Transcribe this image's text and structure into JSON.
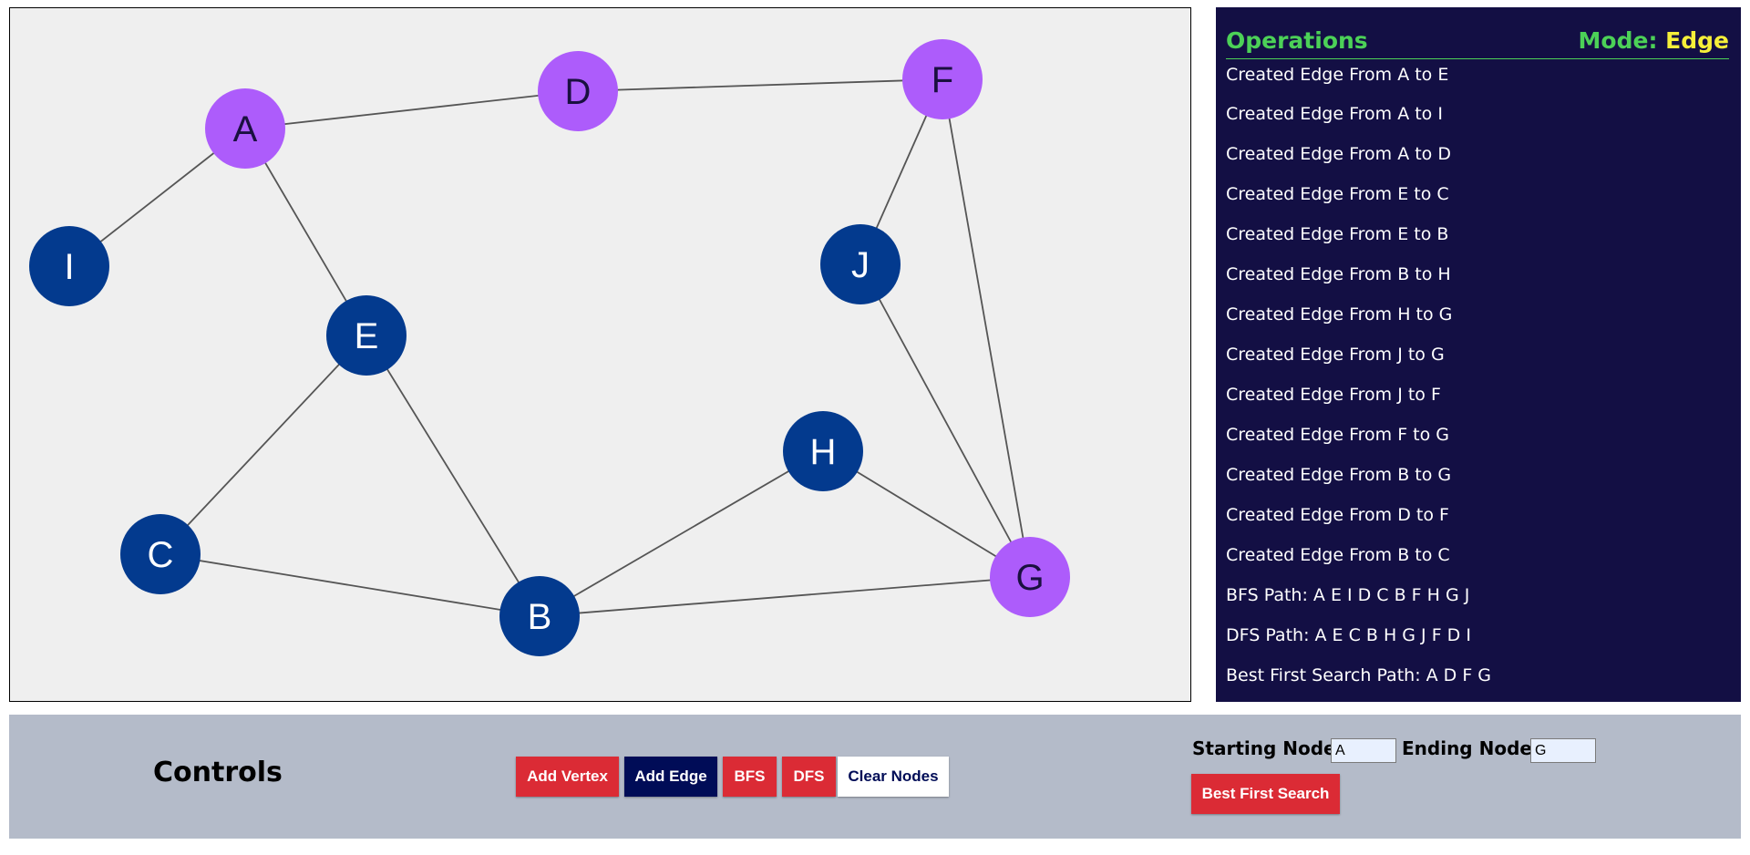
{
  "graph": {
    "nodes": [
      {
        "id": "A",
        "color": "#ad5cfb",
        "label_color": "#1a1040"
      },
      {
        "id": "D",
        "color": "#ad5cfb",
        "label_color": "#1a1040"
      },
      {
        "id": "F",
        "color": "#ad5cfb",
        "label_color": "#1a1040"
      },
      {
        "id": "I",
        "color": "#033a8e",
        "label_color": "#ffffff"
      },
      {
        "id": "J",
        "color": "#033a8e",
        "label_color": "#ffffff"
      },
      {
        "id": "E",
        "color": "#033a8e",
        "label_color": "#ffffff"
      },
      {
        "id": "H",
        "color": "#033a8e",
        "label_color": "#ffffff"
      },
      {
        "id": "C",
        "color": "#033a8e",
        "label_color": "#ffffff"
      },
      {
        "id": "B",
        "color": "#033a8e",
        "label_color": "#ffffff"
      },
      {
        "id": "G",
        "color": "#ad5cfb",
        "label_color": "#1a1040"
      }
    ],
    "edges": [
      [
        "A",
        "E"
      ],
      [
        "A",
        "I"
      ],
      [
        "A",
        "D"
      ],
      [
        "E",
        "C"
      ],
      [
        "E",
        "B"
      ],
      [
        "B",
        "H"
      ],
      [
        "H",
        "G"
      ],
      [
        "J",
        "G"
      ],
      [
        "J",
        "F"
      ],
      [
        "F",
        "G"
      ],
      [
        "B",
        "G"
      ],
      [
        "D",
        "F"
      ],
      [
        "B",
        "C"
      ]
    ]
  },
  "operations": {
    "title": "Operations",
    "mode_label": "Mode:",
    "mode_value": "Edge",
    "items": [
      "Created Edge From A to E",
      "Created Edge From A to I",
      "Created Edge From A to D",
      "Created Edge From E to C",
      "Created Edge From E to B",
      "Created Edge From B to H",
      "Created Edge From H to G",
      "Created Edge From J to G",
      "Created Edge From J to F",
      "Created Edge From F to G",
      "Created Edge From B to G",
      "Created Edge From D to F",
      "Created Edge From B to C",
      "BFS Path: A E I D C B F H G J",
      "DFS Path: A E C B H G J F D I",
      "Best First Search Path: A D F G"
    ]
  },
  "controls": {
    "title": "Controls",
    "add_vertex": "Add Vertex",
    "add_edge": "Add Edge",
    "bfs": "BFS",
    "dfs": "DFS",
    "clear_nodes": "Clear Nodes",
    "starting_node_label": "Starting Node",
    "starting_node_value": "A",
    "ending_node_label": "Ending Node",
    "ending_node_value": "G",
    "best_first_search": "Best First Search"
  },
  "colors": {
    "highlight": "#ad5cfb",
    "default_node": "#033a8e",
    "operations_bg": "#130f44",
    "accent_green": "#4cd157",
    "accent_yellow": "#f5ef39",
    "button_red": "#db2b35",
    "button_navy": "#000c57"
  }
}
